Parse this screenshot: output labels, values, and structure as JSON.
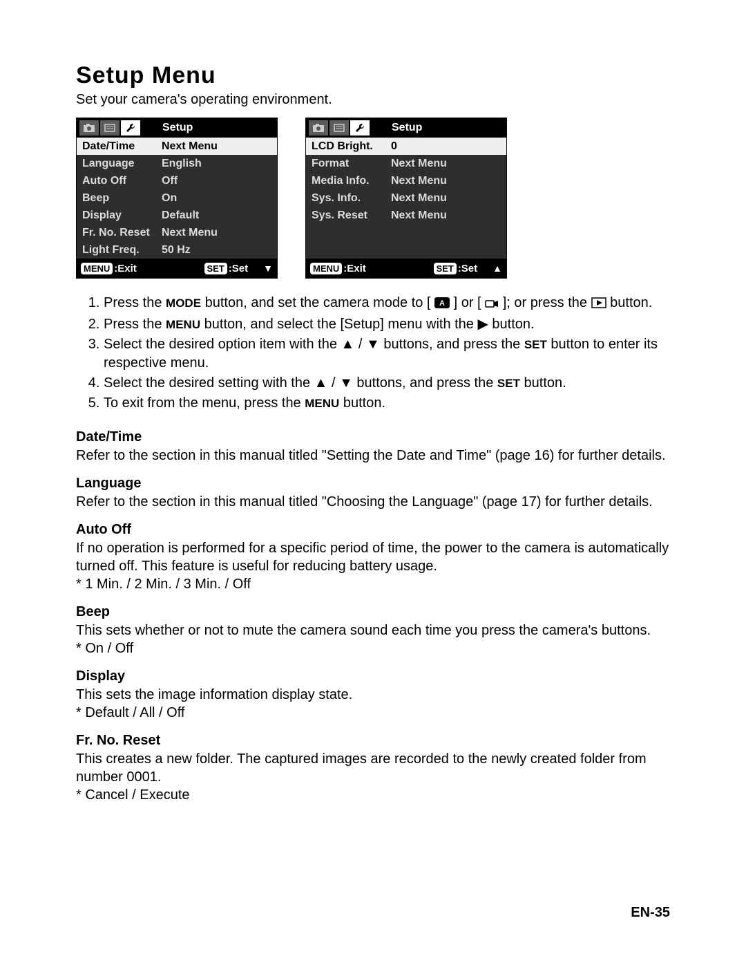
{
  "title": "Setup Menu",
  "subtitle": "Set your camera's operating environment.",
  "screen_left": {
    "header": "Setup",
    "items": [
      {
        "label": "Date/Time",
        "value": "Next Menu",
        "selected": true
      },
      {
        "label": "Language",
        "value": "English"
      },
      {
        "label": "Auto Off",
        "value": "Off"
      },
      {
        "label": "Beep",
        "value": "On"
      },
      {
        "label": "Display",
        "value": "Default"
      },
      {
        "label": "Fr. No. Reset",
        "value": "Next Menu"
      },
      {
        "label": "Light Freq.",
        "value": "50 Hz"
      }
    ],
    "footer_left_chip": "MENU",
    "footer_left_text": ":Exit",
    "footer_right_chip": "SET",
    "footer_right_text": ":Set",
    "arrow": "down"
  },
  "screen_right": {
    "header": "Setup",
    "items": [
      {
        "label": "LCD Bright.",
        "value": "0",
        "selected": true
      },
      {
        "label": "Format",
        "value": "Next Menu"
      },
      {
        "label": "Media Info.",
        "value": "Next Menu"
      },
      {
        "label": "Sys. Info.",
        "value": "Next Menu"
      },
      {
        "label": "Sys. Reset",
        "value": "Next Menu"
      },
      {
        "label": "",
        "value": ""
      },
      {
        "label": "",
        "value": ""
      }
    ],
    "footer_left_chip": "MENU",
    "footer_left_text": ":Exit",
    "footer_right_chip": "SET",
    "footer_right_text": ":Set",
    "arrow": "up"
  },
  "steps": {
    "s1a": "Press the ",
    "s1_mode": "MODE",
    "s1b": " button, and set the camera mode to [ ",
    "s1c": " ] or [",
    "s1d": "]; or press the ",
    "s1e": " button.",
    "s2a": "Press the ",
    "s2_menu": "MENU",
    "s2b": " button, and select the [Setup] menu with the  ▶  button.",
    "s3a": "Select the desired option item with the  ▲ / ▼  buttons, and press the ",
    "s3_set": "SET",
    "s3b": " button to enter its respective menu.",
    "s4a": "Select the desired setting with the  ▲ / ▼  buttons, and press the ",
    "s4_set": "SET",
    "s4b": " button.",
    "s5a": "To exit from the menu, press the ",
    "s5_menu": "MENU",
    "s5b": " button."
  },
  "sections": [
    {
      "title": "Date/Time",
      "body": "Refer to the section in this manual titled \"Setting the Date and Time\" (page 16) for further details."
    },
    {
      "title": "Language",
      "body": "Refer to the section in this manual titled \"Choosing the Language\" (page 17) for further details."
    },
    {
      "title": "Auto Off",
      "body": "If no operation is performed for a specific period of time, the power to the camera is automatically turned off. This feature is useful for reducing battery usage.\n* 1 Min. / 2 Min. / 3 Min. / Off"
    },
    {
      "title": "Beep",
      "body": "This sets whether or not to mute the camera sound each time you press the camera's buttons.\n* On / Off"
    },
    {
      "title": "Display",
      "body": "This sets the image information display state.\n* Default / All / Off"
    },
    {
      "title": "Fr. No. Reset",
      "body": "This creates a new folder. The captured images are recorded to the newly created folder from number 0001.\n* Cancel / Execute"
    }
  ],
  "page_number": "EN-35"
}
